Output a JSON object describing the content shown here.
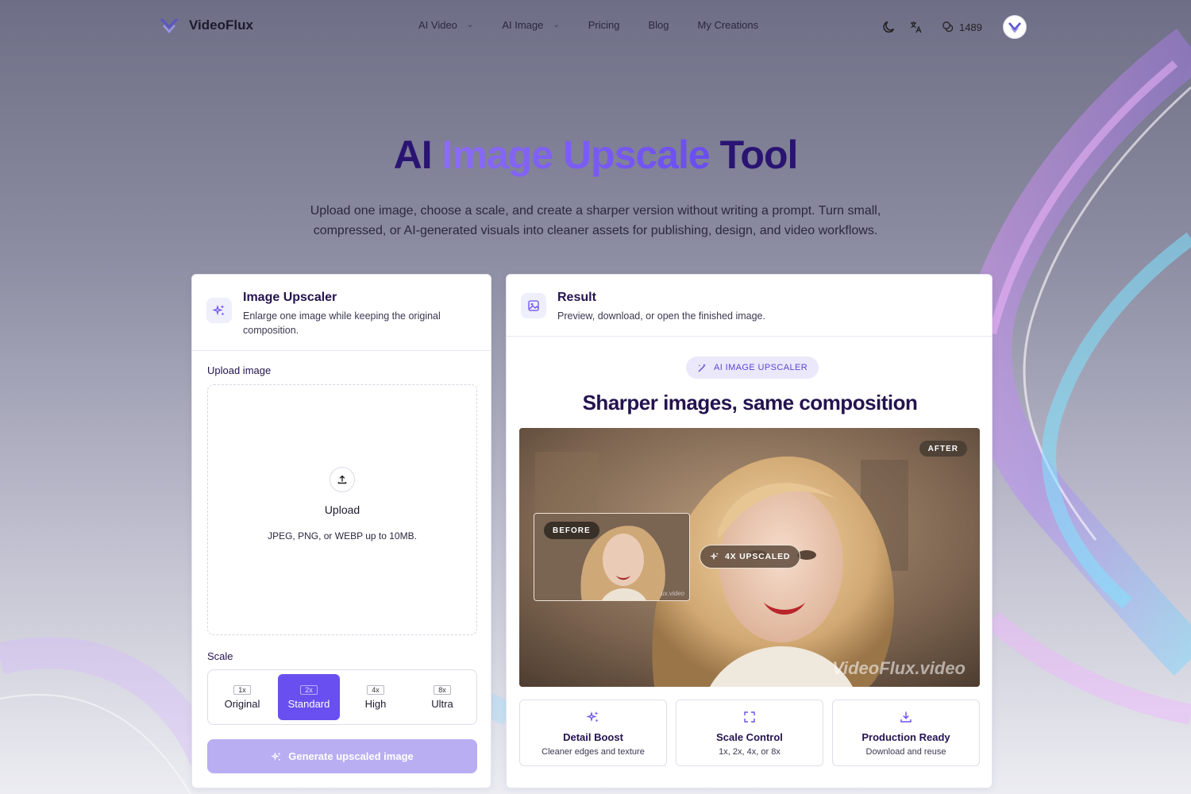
{
  "brand": {
    "name": "VideoFlux"
  },
  "nav": {
    "items": [
      {
        "label": "AI Video",
        "dropdown": true
      },
      {
        "label": "AI Image",
        "dropdown": true
      },
      {
        "label": "Pricing",
        "dropdown": false
      },
      {
        "label": "Blog",
        "dropdown": false
      },
      {
        "label": "My Creations",
        "dropdown": false
      }
    ],
    "credits": "1489",
    "icons": [
      "moon-icon",
      "translate-icon",
      "coins-icon"
    ]
  },
  "hero": {
    "title_prefix": "AI ",
    "title_highlight": "Image Upscale",
    "title_suffix": " Tool",
    "subtitle": "Upload one image, choose a scale, and create a sharper version without writing a prompt. Turn small, compressed, or AI-generated visuals into cleaner assets for publishing, design, and video workflows."
  },
  "upscaler": {
    "title": "Image Upscaler",
    "description": "Enlarge one image while keeping the original composition.",
    "upload_label": "Upload image",
    "upload_title": "Upload",
    "upload_hint": "JPEG, PNG, or WEBP up to 10MB.",
    "scale_label": "Scale",
    "scales": [
      {
        "tag": "1x",
        "label": "Original",
        "active": false
      },
      {
        "tag": "2x",
        "label": "Standard",
        "active": true
      },
      {
        "tag": "4x",
        "label": "High",
        "active": false
      },
      {
        "tag": "8x",
        "label": "Ultra",
        "active": false
      }
    ],
    "generate_label": "Generate upscaled image"
  },
  "result": {
    "title": "Result",
    "description": "Preview, download, or open the finished image.",
    "badge": "AI IMAGE UPSCALER",
    "heading": "Sharper images, same composition",
    "preview": {
      "after_label": "AFTER",
      "before_label": "BEFORE",
      "upscaled_label": "4X UPSCALED",
      "watermark": "VideoFlux.video",
      "small_watermark": "ux.video"
    },
    "features": [
      {
        "icon": "sparkles-icon",
        "title": "Detail Boost",
        "desc": "Cleaner edges and texture"
      },
      {
        "icon": "expand-icon",
        "title": "Scale Control",
        "desc": "1x, 2x, 4x, or 8x"
      },
      {
        "icon": "download-icon",
        "title": "Production Ready",
        "desc": "Download and reuse"
      }
    ]
  },
  "colors": {
    "accent": "#6a4ff0",
    "title_dark": "#2a1472",
    "button_disabled": "#b9aef2"
  }
}
